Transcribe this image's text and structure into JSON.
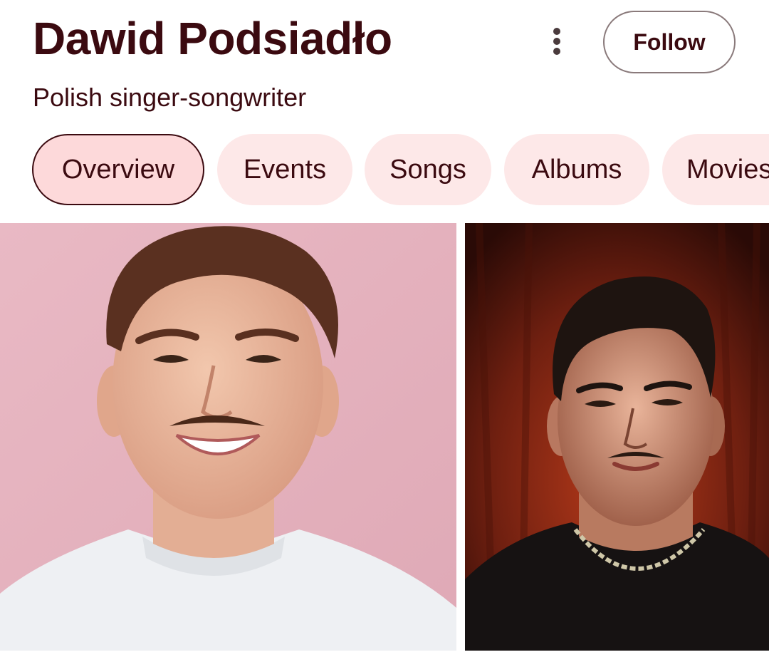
{
  "header": {
    "title": "Dawid Podsiadło",
    "subtitle": "Polish singer-songwriter",
    "follow_label": "Follow",
    "more_icon": "more-vert-icon"
  },
  "tabs": [
    {
      "label": "Overview",
      "active": true
    },
    {
      "label": "Events",
      "active": false
    },
    {
      "label": "Songs",
      "active": false
    },
    {
      "label": "Albums",
      "active": false
    },
    {
      "label": "Movies",
      "active": false
    }
  ],
  "images": [
    {
      "description_name": "artist-photo-smiling-pink-background",
      "background": "#e8b7c1"
    },
    {
      "description_name": "artist-photo-dark-red-background",
      "background": "#5a1a10"
    }
  ],
  "colors": {
    "text": "#3b0a10",
    "chip_bg": "#fde8e8",
    "chip_active_bg": "#fdd9da"
  }
}
